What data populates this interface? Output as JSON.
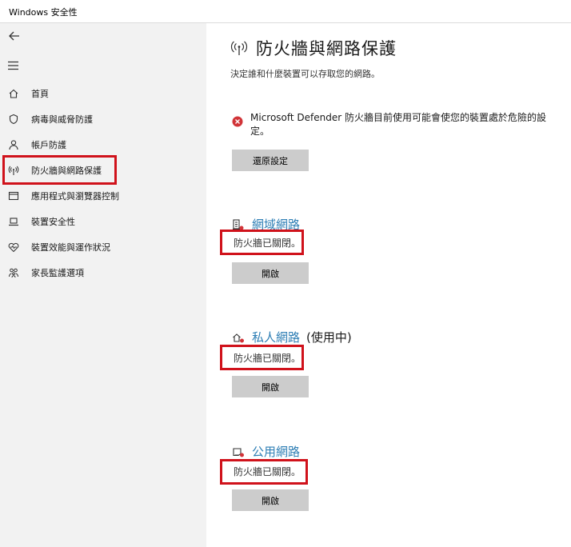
{
  "window": {
    "title": "Windows 安全性"
  },
  "sidebar": {
    "items": [
      {
        "label": "首頁",
        "icon": "home-icon"
      },
      {
        "label": "病毒與威脅防護",
        "icon": "shield-icon"
      },
      {
        "label": "帳戶防護",
        "icon": "person-icon"
      },
      {
        "label": "防火牆與網路保護",
        "icon": "antenna-icon",
        "selected": true
      },
      {
        "label": "應用程式與瀏覽器控制",
        "icon": "browser-window-icon"
      },
      {
        "label": "裝置安全性",
        "icon": "laptop-icon"
      },
      {
        "label": "裝置效能與運作狀況",
        "icon": "heart-pulse-icon"
      },
      {
        "label": "家長監護選項",
        "icon": "family-icon"
      }
    ]
  },
  "main": {
    "title": "防火牆與網路保護",
    "subtitle": "決定誰和什麼裝置可以存取您的網路。",
    "warning": {
      "text": "Microsoft Defender 防火牆目前使用可能會使您的裝置處於危險的設定。",
      "button": "還原設定"
    },
    "networks": [
      {
        "name": "網域網路",
        "extra": "",
        "status": "防火牆已關閉。",
        "button": "開啟",
        "icon": "domain-building-icon"
      },
      {
        "name": "私人網路",
        "extra": "(使用中)",
        "status": "防火牆已關閉。",
        "button": "開啟",
        "icon": "home-network-icon"
      },
      {
        "name": "公用網路",
        "extra": "",
        "status": "防火牆已關閉。",
        "button": "開啟",
        "icon": "public-network-icon"
      }
    ]
  },
  "colors": {
    "accent_link": "#2f7fb5",
    "warning_red": "#d13438",
    "highlight_red": "#d0121b",
    "sidebar_bg": "#f2f2f2",
    "button_bg": "#cccccc"
  }
}
